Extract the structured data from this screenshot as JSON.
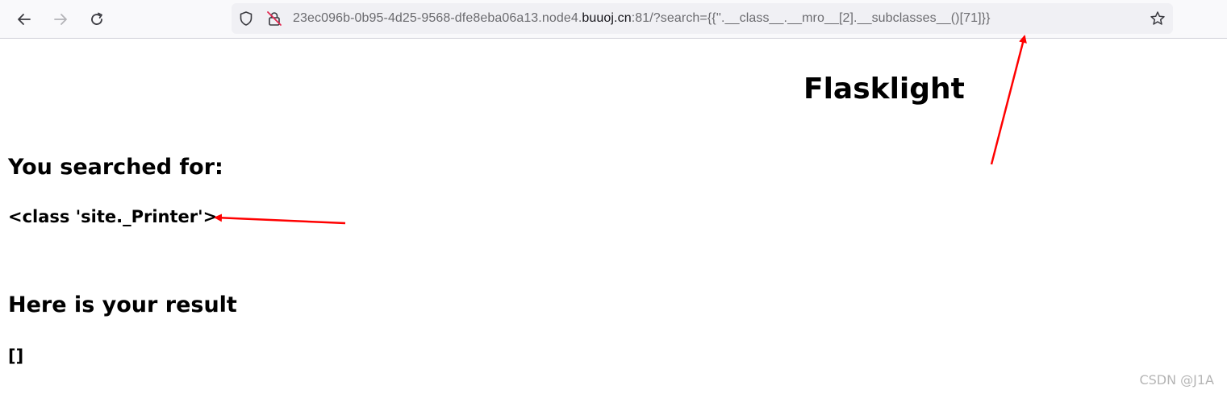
{
  "browser": {
    "url_prefix": "23ec096b-0b95-4d25-9568-dfe8eba06a13.node4.",
    "url_host": "buuoj.cn",
    "url_suffix": ":81/?search={{''.__class__.__mro__[2].__subclasses__()[71]}}",
    "icons": [
      "back-arrow-icon",
      "forward-arrow-icon",
      "reload-icon",
      "shield-icon",
      "insecure-lock-icon",
      "star-icon"
    ]
  },
  "page": {
    "title": "Flasklight",
    "searched_heading": "You searched for:",
    "searched_value": "<class 'site._Printer'>",
    "result_heading": "Here is your result",
    "result_value": "[]"
  },
  "annotation_color": "#ff0000",
  "watermark": "CSDN @J1A"
}
